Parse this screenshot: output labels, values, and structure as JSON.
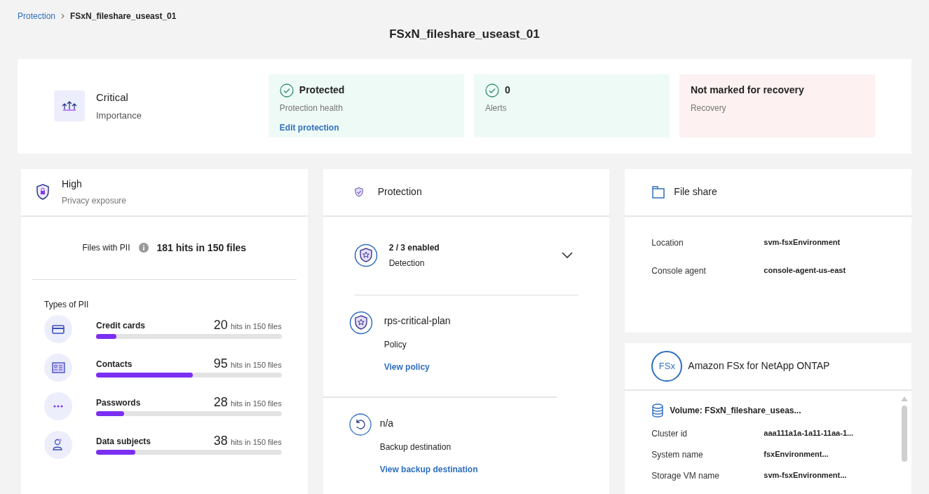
{
  "breadcrumb": [
    {
      "label": "Protection",
      "kind": "link"
    },
    {
      "label": "FSxN_fileshare_useast_01",
      "kind": "current"
    }
  ],
  "title": "FSxN_fileshare_useast_01",
  "importance": {
    "value": "Critical",
    "label": "Importance"
  },
  "status_tiles": [
    {
      "kind": "success",
      "value": "Protected",
      "label": "Protection health",
      "link": "Edit protection"
    },
    {
      "kind": "success",
      "value": "0",
      "label": "Alerts"
    },
    {
      "kind": "danger",
      "value": "Not marked for recovery",
      "label": "Recovery"
    }
  ],
  "privacy": {
    "value": "High",
    "label": "Privacy exposure",
    "files_label": "Files with PII",
    "files_value": "181 hits in 150 files",
    "types_title": "Types of PII",
    "types": [
      {
        "kind": "card",
        "name": "Credit cards",
        "count": "20",
        "suffix": "hits in 150 files",
        "level": 0.11
      },
      {
        "kind": "contact",
        "name": "Contacts",
        "count": "95",
        "suffix": "hits in 150 files",
        "level": 0.52
      },
      {
        "kind": "password",
        "name": "Passwords",
        "count": "28",
        "suffix": "hits in 150 files",
        "level": 0.15
      },
      {
        "kind": "person",
        "name": "Data subjects",
        "count": "38",
        "suffix": "hits in 150 files",
        "level": 0.21
      }
    ]
  },
  "protection": {
    "title": "Protection",
    "detection": {
      "value": "2 / 3 enabled",
      "label": "Detection",
      "expanded": false
    },
    "policy": {
      "value": "rps-critical-plan",
      "label": "Policy",
      "link": "View policy"
    },
    "backup": {
      "value": "n/a",
      "label": "Backup destination",
      "link": "View backup destination"
    }
  },
  "file_share": {
    "title": "File share",
    "rows": [
      {
        "label": "Location",
        "value": "svm-fsxEnvironment"
      },
      {
        "label": "Console agent",
        "value": "console-agent-us-east"
      }
    ]
  },
  "fsx": {
    "logo": "FSx",
    "title": "Amazon FSx for NetApp ONTAP",
    "volume": "Volume: FSxN_fileshare_useas...",
    "rows": [
      {
        "label": "Cluster id",
        "value": "aaa111a1a-1a11-11aa-1..."
      },
      {
        "label": "System name",
        "value": "fsxEnvironment..."
      },
      {
        "label": "Storage VM name",
        "value": "svm-fsxEnvironment..."
      }
    ]
  }
}
